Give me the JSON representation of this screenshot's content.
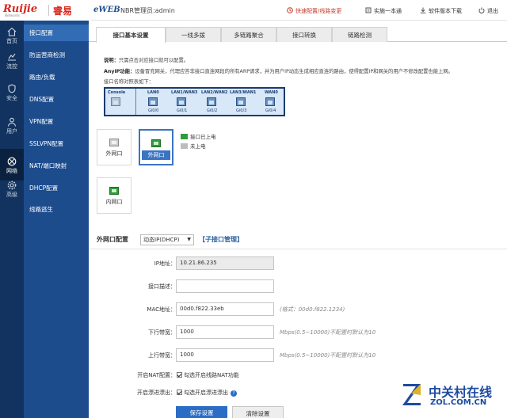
{
  "header": {
    "brand": "Ruijie",
    "brand_sub": "Networks",
    "brand_cn": "睿易",
    "eweb": "eWEB",
    "admin": "NBR管理员:admin",
    "links": {
      "quick_config": "快速配置/线路变更",
      "one_stop": "实施一本通",
      "download": "软件版本下载",
      "logout": "退出"
    }
  },
  "nav": {
    "items": [
      {
        "label": "首页"
      },
      {
        "label": "流控"
      },
      {
        "label": "安全"
      },
      {
        "label": "用户"
      },
      {
        "label": "网络"
      },
      {
        "label": "高级"
      }
    ]
  },
  "submenu": {
    "items": [
      {
        "label": "接口配置"
      },
      {
        "label": "防运营商检测"
      },
      {
        "label": "路由/负载"
      },
      {
        "label": "DNS配置"
      },
      {
        "label": "VPN配置"
      },
      {
        "label": "SSLVPN配置"
      },
      {
        "label": "NAT/端口映射"
      },
      {
        "label": "DHCP配置"
      },
      {
        "label": "线路逃生"
      }
    ]
  },
  "tabs": [
    {
      "label": "接口基本设置"
    },
    {
      "label": "一线多拨"
    },
    {
      "label": "多链路聚合"
    },
    {
      "label": "接口转换"
    },
    {
      "label": "链路检测"
    }
  ],
  "notes": {
    "desc_label": "说明：",
    "desc_text": "只需点击对应接口就可以配置。",
    "anyip_label": "AnyIP功能：",
    "anyip_text": "设备冒充网关，代理应答非接口直连网段的所有ARP请求，并为用户IP动态生成相应直连的路由，使得配置IP和网关的用户不修改配置也能上网。",
    "port_title": "接口名称对照表如下："
  },
  "ports": [
    {
      "name": "Console",
      "gi": ""
    },
    {
      "name": "LAN0",
      "gi": "Gi0/0"
    },
    {
      "name": "LAN1/WAN3",
      "gi": "Gi0/1"
    },
    {
      "name": "LAN2/WAN2",
      "gi": "Gi0/2"
    },
    {
      "name": "LAN3/WAN1",
      "gi": "Gi0/3"
    },
    {
      "name": "WAN0",
      "gi": "Gi0/4"
    }
  ],
  "interfaces": {
    "wan_label": "外网口",
    "wan_active_label": "外网口",
    "lan_label": "内网口"
  },
  "legend": {
    "powered": "接口已上电",
    "not_powered": "未上电"
  },
  "form": {
    "title": "外网口配置",
    "mode": "动态IP(DHCP)",
    "subif_link": "【子接口管理】",
    "ip_label": "IP地址：",
    "ip_value": "10.21.86.235",
    "desc_label": "接口描述：",
    "desc_value": "",
    "mac_label": "MAC地址：",
    "mac_value": "00d0.f822.33eb",
    "mac_hint": "(格式：00d0.f822.1234)",
    "down_label": "下行带宽：",
    "down_value": "1000",
    "down_hint": "Mbps(0.5~10000)不配置时默认为10",
    "up_label": "上行带宽：",
    "up_value": "1000",
    "up_hint": "Mbps(0.5~10000)不配置时默认为10",
    "nat_label": "开启NAT配置：",
    "nat_text": "勾选开启线路NAT功能",
    "drift_label": "开启漂进漂出：",
    "drift_text": "勾选开启漂进漂出",
    "save": "保存设置",
    "clear": "清除设置"
  },
  "watermark": {
    "cn": "中关村在线",
    "en": "ZOL.COM.CN"
  },
  "colors": {
    "nav_bg": "#12335f",
    "submenu_bg": "#1d4c8d",
    "submenu_active": "#326cb5",
    "brand_red": "#d9261c",
    "primary": "#2b6cc4",
    "powered_green": "#2e9d3a"
  }
}
